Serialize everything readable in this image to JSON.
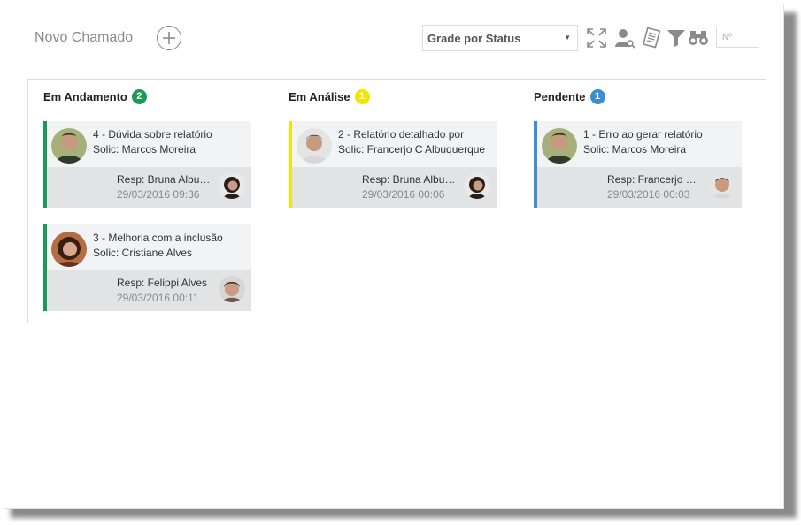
{
  "toolbar": {
    "new_ticket_label": "Novo Chamado",
    "view_select": "Grade por Status",
    "number_placeholder": "Nº",
    "icons": [
      "add-icon",
      "expand-icon",
      "user-search-icon",
      "report-icon",
      "filter-icon",
      "binoculars-icon"
    ]
  },
  "columns": [
    {
      "title": "Em Andamento",
      "count": "2",
      "color": "#1a9a54",
      "cards": [
        {
          "title": "4 - Dúvida sobre relatório",
          "solic": "Solic: Marcos Moreira",
          "resp": "Resp: Bruna Albuquerque",
          "date": "29/03/2016 09:36"
        },
        {
          "title": "3 - Melhoria com a inclusão",
          "solic": "Solic: Cristiane Alves",
          "resp": "Resp: Felippi Alves",
          "date": "29/03/2016 00:11"
        }
      ]
    },
    {
      "title": "Em Análise",
      "count": "1",
      "color": "#f5e400",
      "cards": [
        {
          "title": "2 - Relatório detalhado por",
          "solic": "Solic: Francerjo C Albuquerque",
          "resp": "Resp: Bruna Albuquerque",
          "date": "29/03/2016 00:06"
        }
      ]
    },
    {
      "title": "Pendente",
      "count": "1",
      "color": "#3b8ed3",
      "cards": [
        {
          "title": "1 - Erro ao gerar relatório",
          "solic": "Solic: Marcos Moreira",
          "resp": "Resp: Francerjo C Albuquerque",
          "date": "29/03/2016 00:03"
        }
      ]
    }
  ]
}
